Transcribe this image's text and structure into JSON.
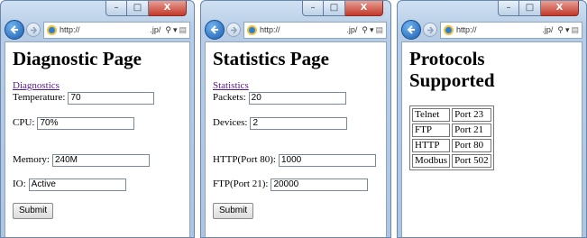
{
  "window_controls": {
    "minimize": "–",
    "maximize": "□",
    "close": "X"
  },
  "windows": [
    {
      "address": {
        "prefix": "http://",
        "domain": ".jp/"
      },
      "page_title": "Diagnostic Page",
      "link": "Diagnostics",
      "fields": [
        {
          "label": "Temperature:",
          "value": "70"
        },
        {
          "label": "CPU:",
          "value": "70%"
        },
        {
          "label": "Memory:",
          "value": "240M"
        },
        {
          "label": "IO:",
          "value": "Active"
        }
      ],
      "submit": "Submit"
    },
    {
      "address": {
        "prefix": "http://",
        "domain": ".jp/"
      },
      "page_title": "Statistics Page",
      "link": "Statistics",
      "fields": [
        {
          "label": "Packets:",
          "value": "20"
        },
        {
          "label": "Devices:",
          "value": "2"
        },
        {
          "label": "HTTP(Port 80):",
          "value": "1000"
        },
        {
          "label": "FTP(Port 21):",
          "value": "20000"
        }
      ],
      "submit": "Submit"
    },
    {
      "address": {
        "prefix": "http://",
        "domain": ".jp/"
      },
      "page_title_line1": "Protocols",
      "page_title_line2": "Supported",
      "protocols": [
        {
          "name": "Telnet",
          "port": "Port 23"
        },
        {
          "name": "FTP",
          "port": "Port 21"
        },
        {
          "name": "HTTP",
          "port": "Port 80"
        },
        {
          "name": "Modbus",
          "port": "Port 502"
        }
      ]
    }
  ]
}
